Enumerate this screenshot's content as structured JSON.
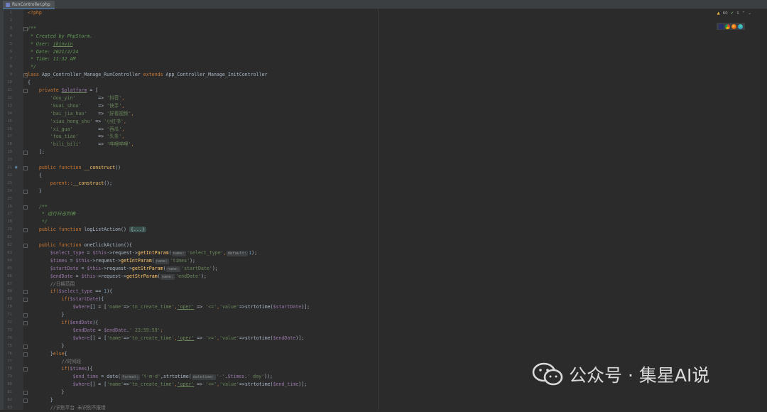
{
  "tab": {
    "file_name": "RunController.php"
  },
  "inspection": {
    "warnings": "60",
    "typos": "1"
  },
  "browsers": [
    "phpstorm-icon",
    "chrome-icon",
    "firefox-icon",
    "edge-icon"
  ],
  "line_numbers": [
    "1",
    "2",
    "3",
    "4",
    "5",
    "6",
    "7",
    "8",
    "9",
    "10",
    "11",
    "12",
    "13",
    "14",
    "15",
    "16",
    "17",
    "18",
    "19",
    "20",
    "21",
    "22",
    "23",
    "24",
    "25",
    "26",
    "27",
    "28",
    "29",
    "61",
    "62",
    "63",
    "64",
    "65",
    "66",
    "67",
    "68",
    "69",
    "70",
    "71",
    "72",
    "73",
    "74",
    "75",
    "76",
    "77",
    "78",
    "79",
    "80",
    "81",
    "82",
    "83"
  ],
  "code": {
    "l1": "<?php",
    "l3": "/**",
    "l4": " * Created by PhpStorm.",
    "l5a": " * User: ",
    "l5b": "ikinvin",
    "l6": " * Date: 2021/2/24",
    "l7": " * Time: 11:32 AM",
    "l8": " */",
    "l9a": "class",
    "l9b": " App_Controller_Manage_RunController ",
    "l9c": "extends",
    "l9d": " App_Controller_Manage_InitController",
    "l10": "{",
    "l11a": "    private ",
    "l11b": "$platform",
    "l11c": " = [",
    "l12a": "        'dou_yin'",
    "l12b": "        => ",
    "l12c": "'抖音'",
    "l12d": ",",
    "l13a": "        'kuai_shou'",
    "l13b": "      => ",
    "l13c": "'快手'",
    "l13d": ",",
    "l14a": "        'bai_jia_hao'",
    "l14b": "    => ",
    "l14c": "'好看视频'",
    "l14d": ",",
    "l15a": "        'xiao_hong_shu'",
    "l15b": " => ",
    "l15c": "'小红书'",
    "l15d": ",",
    "l16a": "        'xi_gua'",
    "l16b": "         => ",
    "l16c": "'西瓜'",
    "l16d": ",",
    "l17a": "        'tou_tiao'",
    "l17b": "       => ",
    "l17c": "'头条'",
    "l17d": ",",
    "l18a": "        'bili_bili'",
    "l18b": "      => ",
    "l18c": "'哔哩哔哩'",
    "l18d": ",",
    "l19": "    ];",
    "l21a": "    public function ",
    "l21b": "__construct",
    "l21c": "()",
    "l22": "    {",
    "l23a": "        parent::",
    "l23b": "__construct",
    "l23c": "();",
    "l24": "    }",
    "l26": "    /**",
    "l27": "     * 运行日志列表",
    "l28": "     */",
    "l29a": "    public function ",
    "l29b": "logListAction",
    "l29c": "() ",
    "l29d": "{...}",
    "l61a": "    public function ",
    "l61b": "oneClickAction",
    "l61c": "(){",
    "l62a": "        ",
    "l62b": "$select_type",
    "l62c": " = ",
    "l62d": "$this",
    "l62e": "->request->",
    "l62f": "getIntParam",
    "l62g": "(",
    "l62h": "name:",
    "l62i": "'select_type'",
    "l62j": ",",
    "l62k": "default:",
    "l62l": "1",
    "l62m": ");",
    "l63a": "        ",
    "l63b": "$times",
    "l63c": " = ",
    "l63d": "$this",
    "l63e": "->request->",
    "l63f": "getIntParam",
    "l63g": "(",
    "l63h": "name:",
    "l63i": "'times'",
    "l63j": ");",
    "l64a": "        ",
    "l64b": "$startDate",
    "l64c": " = ",
    "l64d": "$this",
    "l64e": "->request->",
    "l64f": "getStrParam",
    "l64g": "(",
    "l64h": "name:",
    "l64i": "'startDate'",
    "l64j": ");",
    "l65a": "        ",
    "l65b": "$endDate",
    "l65c": " = ",
    "l65d": "$this",
    "l65e": "->request->",
    "l65f": "getStrParam",
    "l65g": "(",
    "l65h": "name:",
    "l65i": "'endDate'",
    "l65j": ");",
    "l66": "        //日期范围",
    "l67a": "        if(",
    "l67b": "$select_type",
    "l67c": " == ",
    "l67d": "1",
    "l67e": "){",
    "l68a": "            if(",
    "l68b": "$startDate",
    "l68c": "){",
    "l69a": "                ",
    "l69b": "$where",
    "l69c": "[] = [",
    "l69d": "'name'",
    "l69e": "=>",
    "l69f": "'tn_create_time'",
    "l69g": ",",
    "l69h": "'oper'",
    "l69i": " => ",
    "l69j": "'<='",
    "l69k": ",",
    "l69l": "'value'",
    "l69m": "=>strtotime(",
    "l69n": "$startDate",
    "l69o": ")];",
    "l70": "            }",
    "l71a": "            if(",
    "l71b": "$endDate",
    "l71c": "){",
    "l72a": "                ",
    "l72b": "$endDate",
    "l72c": " = ",
    "l72d": "$endDate",
    "l72e": ".",
    "l72f": "' 23:59:59'",
    "l72g": ";",
    "l73a": "                ",
    "l73b": "$where",
    "l73c": "[] = [",
    "l73d": "'name'",
    "l73e": "=>",
    "l73f": "'tn_create_time'",
    "l73g": ",",
    "l73h": "'oper'",
    "l73i": " => ",
    "l73j": "'>='",
    "l73k": ",",
    "l73l": "'value'",
    "l73m": "=>strtotime(",
    "l73n": "$endDate",
    "l73o": ")];",
    "l74": "            }",
    "l75a": "        }",
    "l75b": "else",
    "l75c": "{",
    "l76": "            //时间段",
    "l77a": "            if(",
    "l77b": "$times",
    "l77c": "){",
    "l78a": "                ",
    "l78b": "$end_time",
    "l78c": " = date(",
    "l78d": "format:",
    "l78e": "'Y-m-d'",
    "l78f": ",strtotime(",
    "l78g": "datetime:",
    "l78h": "'-'",
    "l78i": ".",
    "l78j": "$times",
    "l78k": ".",
    "l78l": "' day'",
    "l78m": "));",
    "l79a": "                ",
    "l79b": "$where",
    "l79c": "[] = [",
    "l79d": "'name'",
    "l79e": "=>",
    "l79f": "'tn_create_time'",
    "l79g": ",",
    "l79h": "'oper'",
    "l79i": " => ",
    "l79j": "'<='",
    "l79k": ",",
    "l79l": "'value'",
    "l79m": "=>strtotime(",
    "l79n": "$end_time",
    "l79o": ")];",
    "l80": "            }",
    "l81": "        }",
    "l82": "        //识别平台 未识别不报错"
  },
  "watermark": {
    "text": "公众号 · 集星AI说"
  }
}
